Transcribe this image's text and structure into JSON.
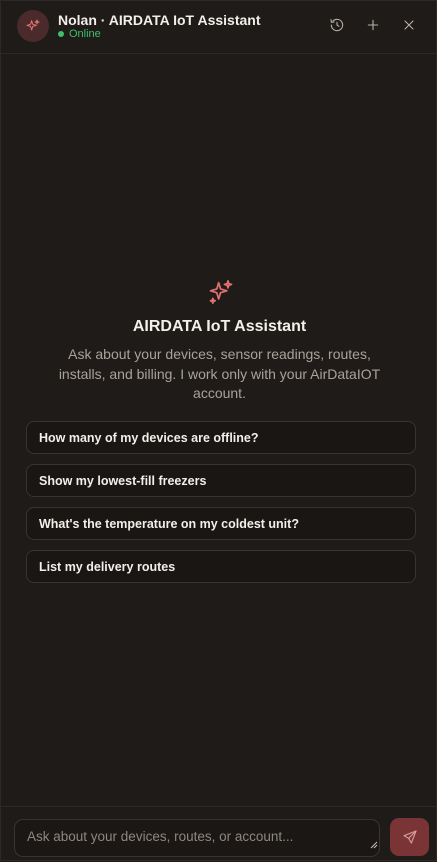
{
  "header": {
    "title": "Nolan · AIRDATA IoT Assistant",
    "status": "Online",
    "status_color": "#3fbf6a",
    "avatar_icon": "sparkle-icon",
    "actions": [
      "history-icon",
      "plus-icon",
      "close-icon"
    ]
  },
  "empty_state": {
    "icon": "sparkle-icon",
    "title": "AIRDATA IoT Assistant",
    "description": "Ask about your devices, sensor readings, routes, installs, and billing. I work only with your AirDataIOT account."
  },
  "suggestions": [
    "How many of my devices are offline?",
    "Show my lowest-fill freezers",
    "What's the temperature on my coldest unit?",
    "List my delivery routes"
  ],
  "composer": {
    "placeholder": "Ask about your devices, routes, or account...",
    "value": "",
    "send_icon": "send-icon"
  },
  "colors": {
    "background": "#1f1b18",
    "accent": "#e07070",
    "send_button": "#7a3436"
  }
}
